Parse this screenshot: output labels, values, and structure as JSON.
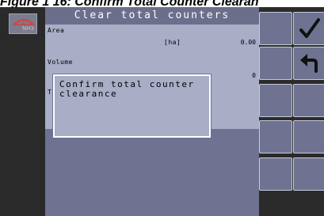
{
  "figure": {
    "caption": "Figure 1 16: Confirm Total Counter Clearan"
  },
  "crop_selector": {
    "tag": "NH3"
  },
  "screen": {
    "title": "Clear total counters",
    "rows": [
      {
        "label": "Area",
        "unit": "[ha]",
        "value": "0.00"
      },
      {
        "label": "Volume",
        "unit": "",
        "value": "0"
      },
      {
        "label": "T",
        "unit": "",
        "value": ""
      }
    ]
  },
  "dialog": {
    "line1": "Confirm total counter",
    "line2": "clearance"
  },
  "buttons": [
    {
      "icon": "checkmark-icon"
    },
    {
      "icon": "back-arrow-icon"
    },
    {
      "icon": ""
    },
    {
      "icon": ""
    },
    {
      "icon": ""
    }
  ],
  "colors": {
    "panel": "#6f7391",
    "row": "#a9adc6",
    "frame": "#2b2b2b"
  }
}
